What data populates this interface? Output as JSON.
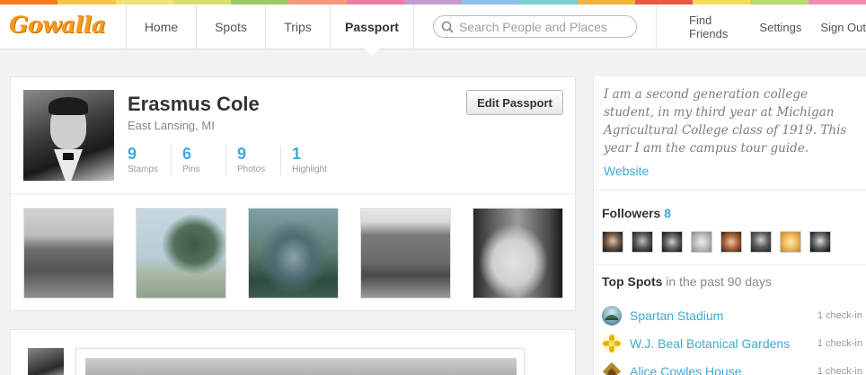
{
  "colors": {
    "accent": "#3fa9d6",
    "logo": "#f39a1e",
    "stripe": [
      "#f47b20",
      "#f8c54a",
      "#f3e17a",
      "#d7e06b",
      "#9ccc65",
      "#f49b7b",
      "#ee7ca8",
      "#c69bd1",
      "#8bc2e8",
      "#78cfd1",
      "#f4b33b",
      "#e85a3f",
      "#f9dc5c",
      "#b9dd6c",
      "#f28ab2"
    ]
  },
  "header": {
    "logo": "Gowalla",
    "nav": [
      {
        "label": "Home",
        "active": false
      },
      {
        "label": "Spots",
        "active": false
      },
      {
        "label": "Trips",
        "active": false
      },
      {
        "label": "Passport",
        "active": true
      }
    ],
    "search_placeholder": "Search People and Places",
    "right_nav": [
      "Find Friends",
      "Settings",
      "Sign Out"
    ]
  },
  "profile": {
    "name": "Erasmus Cole",
    "location": "East Lansing, MI",
    "edit_button": "Edit Passport",
    "stats": [
      {
        "value": "9",
        "label": "Stamps"
      },
      {
        "value": "6",
        "label": "Pins"
      },
      {
        "value": "9",
        "label": "Photos"
      },
      {
        "value": "1",
        "label": "Highlight"
      }
    ]
  },
  "sidebar": {
    "bio": "I am a second generation college student, in my third year at Michigan Agricultural College class of 1919. This year I am the campus tour guide.",
    "website": "Website",
    "followers_label": "Followers",
    "followers_count": "8",
    "top_spots_label": "Top Spots",
    "top_spots_period": "in the past 90 days",
    "spots": [
      {
        "name": "Spartan Stadium",
        "checkins": "1 check-in",
        "icon": "stadium-icon"
      },
      {
        "name": "W.J. Beal Botanical Gardens",
        "checkins": "1 check-in",
        "icon": "flower-icon"
      },
      {
        "name": "Alice Cowles House",
        "checkins": "1 check-in",
        "icon": "house-icon"
      }
    ]
  }
}
